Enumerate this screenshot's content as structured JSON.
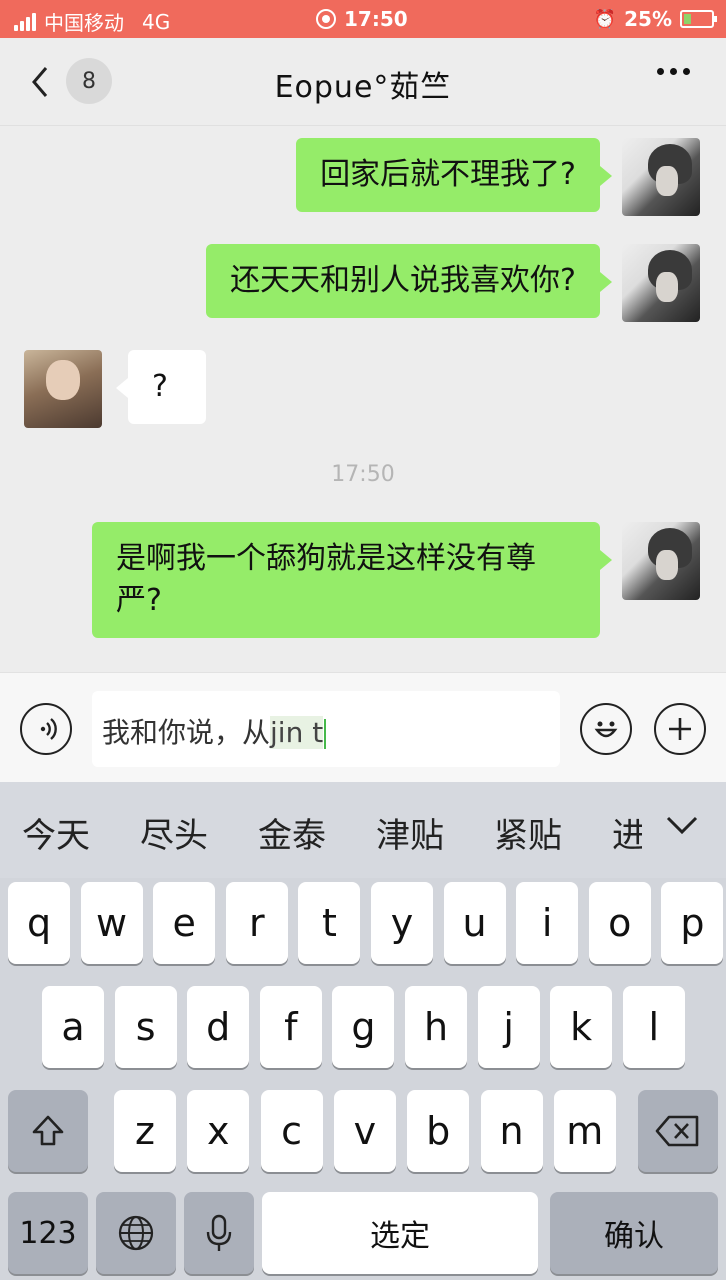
{
  "status_bar": {
    "carrier": "中国移动",
    "network": "4G",
    "time": "17:50",
    "battery": "25%",
    "battery_level": 0.25
  },
  "nav": {
    "unread_count": "8",
    "title": "Eopue°茹竺"
  },
  "messages": [
    {
      "from": "me",
      "text": "回家后就不理我了?"
    },
    {
      "from": "me",
      "text": "还天天和别人说我喜欢你?"
    },
    {
      "from": "her",
      "text": "?"
    },
    {
      "timestamp": "17:50"
    },
    {
      "from": "me",
      "text": "是啊我一个舔狗就是这样没有尊严?"
    }
  ],
  "input": {
    "committed": "我和你说，从",
    "composing": "jin t"
  },
  "keyboard": {
    "candidates": [
      "今天",
      "尽头",
      "金泰",
      "津贴",
      "紧贴",
      "进"
    ],
    "row1": [
      "q",
      "w",
      "e",
      "r",
      "t",
      "y",
      "u",
      "i",
      "o",
      "p"
    ],
    "row2": [
      "a",
      "s",
      "d",
      "f",
      "g",
      "h",
      "j",
      "k",
      "l"
    ],
    "row3": [
      "z",
      "x",
      "c",
      "v",
      "b",
      "n",
      "m"
    ],
    "numbers_key": "123",
    "space_key": "选定",
    "confirm_key": "确认"
  },
  "colors": {
    "status_bar": "#f06a5c",
    "sent_bubble": "#95ec69",
    "received_bubble": "#ffffff",
    "background": "#ededed",
    "keyboard": "#d2d5db"
  },
  "icons": [
    "signal-icon",
    "timer-icon",
    "alarm-icon",
    "battery-icon",
    "back-arrow-icon",
    "more-icon",
    "voice-icon",
    "emoji-icon",
    "plus-icon",
    "shift-icon",
    "backspace-icon",
    "globe-icon",
    "microphone-icon",
    "collapse-chevron-icon"
  ]
}
